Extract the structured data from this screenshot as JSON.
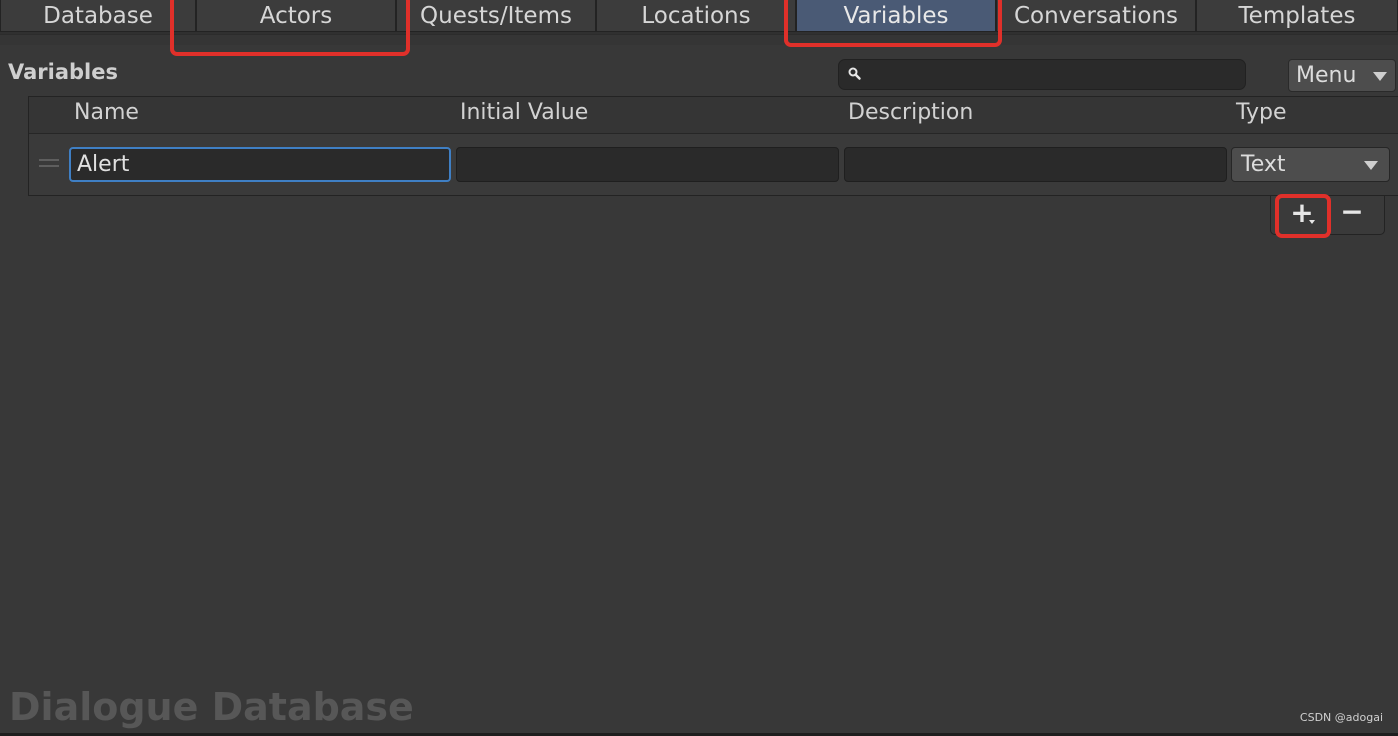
{
  "tabs": [
    {
      "label": "Database",
      "active": false
    },
    {
      "label": "Actors",
      "active": false
    },
    {
      "label": "Quests/Items",
      "active": false
    },
    {
      "label": "Locations",
      "active": false
    },
    {
      "label": "Variables",
      "active": true
    },
    {
      "label": "Conversations",
      "active": false
    },
    {
      "label": "Templates",
      "active": false
    }
  ],
  "section": {
    "title": "Variables"
  },
  "search": {
    "value": "",
    "icon": "search-icon"
  },
  "menu": {
    "label": "Menu"
  },
  "table": {
    "columns": [
      "Name",
      "Initial Value",
      "Description",
      "Type"
    ],
    "rows": [
      {
        "name": "Alert",
        "initial_value": "",
        "description": "",
        "type": "Text"
      }
    ]
  },
  "footer": {
    "add_label": "+",
    "remove_label": "−"
  },
  "watermark": "Dialogue Database",
  "credit": "CSDN @adogai",
  "colors": {
    "active_tab": "#4a5a75",
    "highlight": "#e0302a",
    "focus": "#3f7fc4"
  }
}
